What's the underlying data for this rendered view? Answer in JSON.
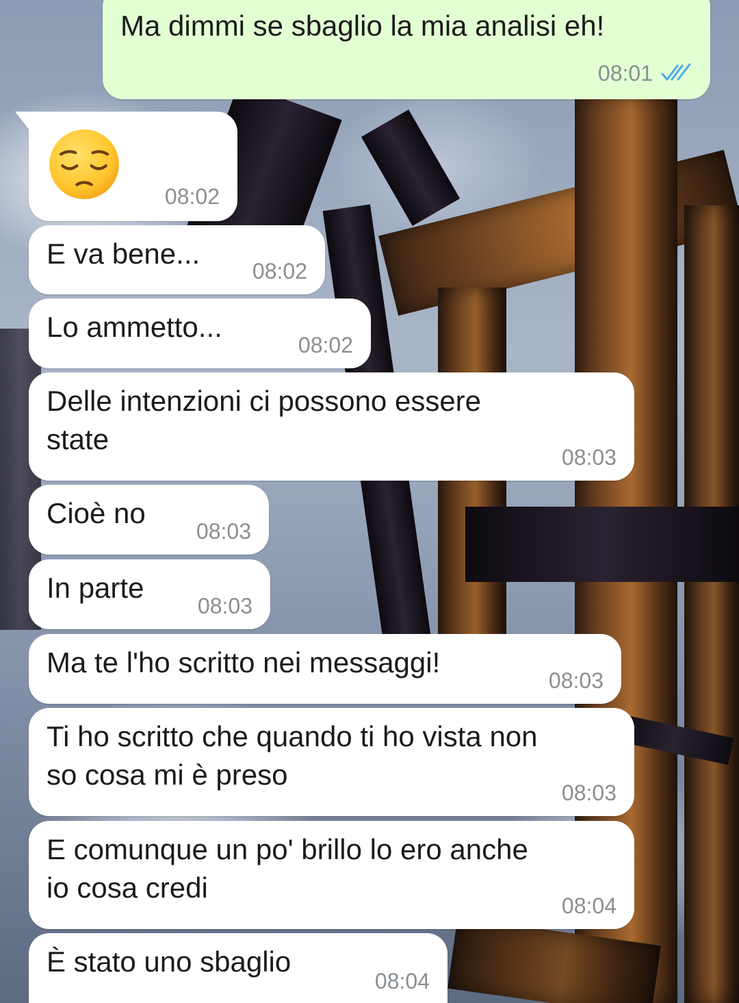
{
  "theme": {
    "incoming_bubble_color": "#ffffff",
    "outgoing_bubble_color": "#e2ffd4",
    "timestamp_color": "#8a8f93",
    "read_tick_color": "#4fa8e8"
  },
  "messages": [
    {
      "direction": "outgoing",
      "text": "Ma dimmi se sbaglio la mia analisi eh!",
      "time": "08:01",
      "status_icon": "double-check-read-icon"
    },
    {
      "direction": "incoming",
      "emoji": "pensive-face-icon",
      "time": "08:02"
    },
    {
      "direction": "incoming",
      "text": "E va bene...",
      "time": "08:02"
    },
    {
      "direction": "incoming",
      "text": "Lo ammetto...",
      "time": "08:02"
    },
    {
      "direction": "incoming",
      "text": "Delle intenzioni ci possono essere\nstate",
      "time": "08:03"
    },
    {
      "direction": "incoming",
      "text": "Cioè no",
      "time": "08:03"
    },
    {
      "direction": "incoming",
      "text": "In parte",
      "time": "08:03"
    },
    {
      "direction": "incoming",
      "text": "Ma te l'ho scritto nei messaggi!",
      "time": "08:03"
    },
    {
      "direction": "incoming",
      "text": "Ti ho scritto che quando ti ho vista non\nso cosa mi è preso",
      "time": "08:03"
    },
    {
      "direction": "incoming",
      "text": "E comunque un po' brillo lo ero anche\nio cosa credi",
      "time": "08:04"
    },
    {
      "direction": "incoming",
      "text": "È stato uno sbaglio",
      "time": "08:04"
    }
  ]
}
